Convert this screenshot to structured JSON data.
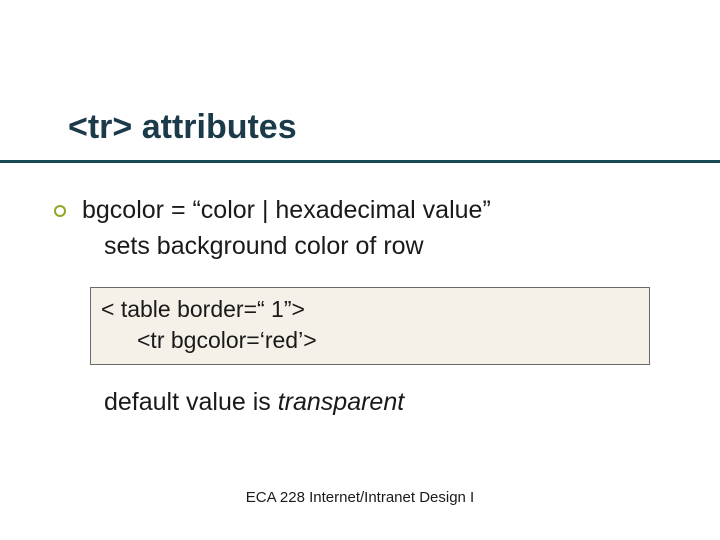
{
  "title": "<tr> attributes",
  "body": {
    "line1": "bgcolor = “color | hexadecimal value”",
    "line2": "sets background color of row"
  },
  "code": {
    "line1": "< table border=“ 1”>",
    "line2": "<tr bgcolor=‘red’>"
  },
  "default_prefix": "default value is ",
  "default_italic": "transparent",
  "footer": "ECA 228  Internet/Intranet Design I"
}
